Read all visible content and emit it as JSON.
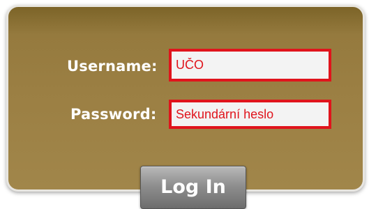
{
  "login": {
    "username_label": "Username:",
    "username_value": "UČO",
    "password_label": "Password:",
    "password_value": "Sekundární heslo",
    "submit_label": "Log In"
  },
  "colors": {
    "panel": "#9b7f43",
    "input_border": "#e0141c",
    "input_text": "#e0141c",
    "button": "#8f8f8f"
  }
}
